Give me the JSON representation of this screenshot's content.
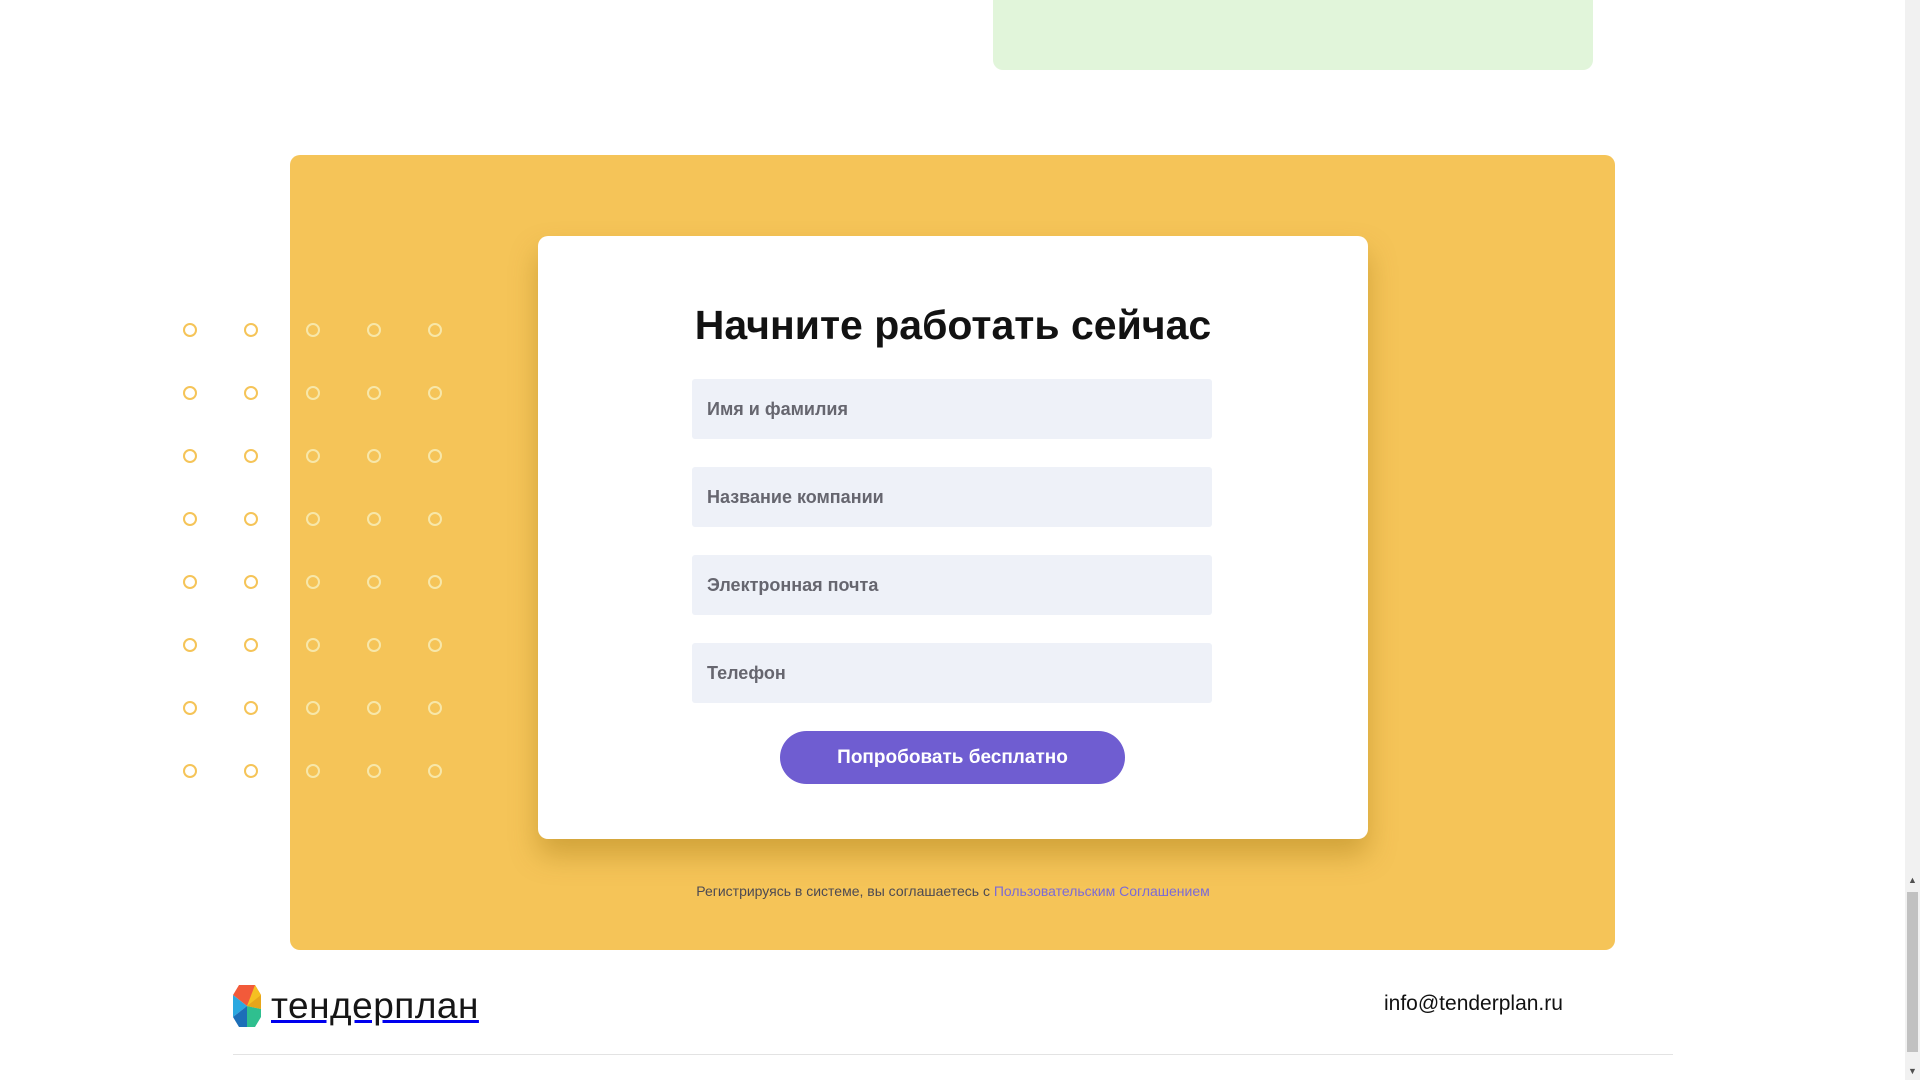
{
  "form": {
    "title": "Начните работать сейчас",
    "fields": [
      {
        "placeholder": "Имя и фамилия",
        "value": ""
      },
      {
        "placeholder": "Название компании",
        "value": ""
      },
      {
        "placeholder": "Электронная почта",
        "value": ""
      },
      {
        "placeholder": "Телефон",
        "value": ""
      }
    ],
    "submit_label": "Попробовать бесплатно"
  },
  "terms": {
    "text": "Регистрируясь в системе, вы соглашаетесь с ",
    "link_text": "Пользовательским Соглашением"
  },
  "footer": {
    "logo_text": "тендерплан",
    "email": "info@tenderplan.ru"
  },
  "colors": {
    "panel": "#f5c458",
    "accent": "#6f5dd1",
    "link": "#7b6ad6",
    "field_bg": "#eef1f8",
    "green_block": "#e1f5da"
  },
  "icons": {
    "logo": "tenderplan-logo-icon",
    "scroll_up": "scroll-up-arrow-icon",
    "scroll_down": "scroll-down-arrow-icon"
  }
}
